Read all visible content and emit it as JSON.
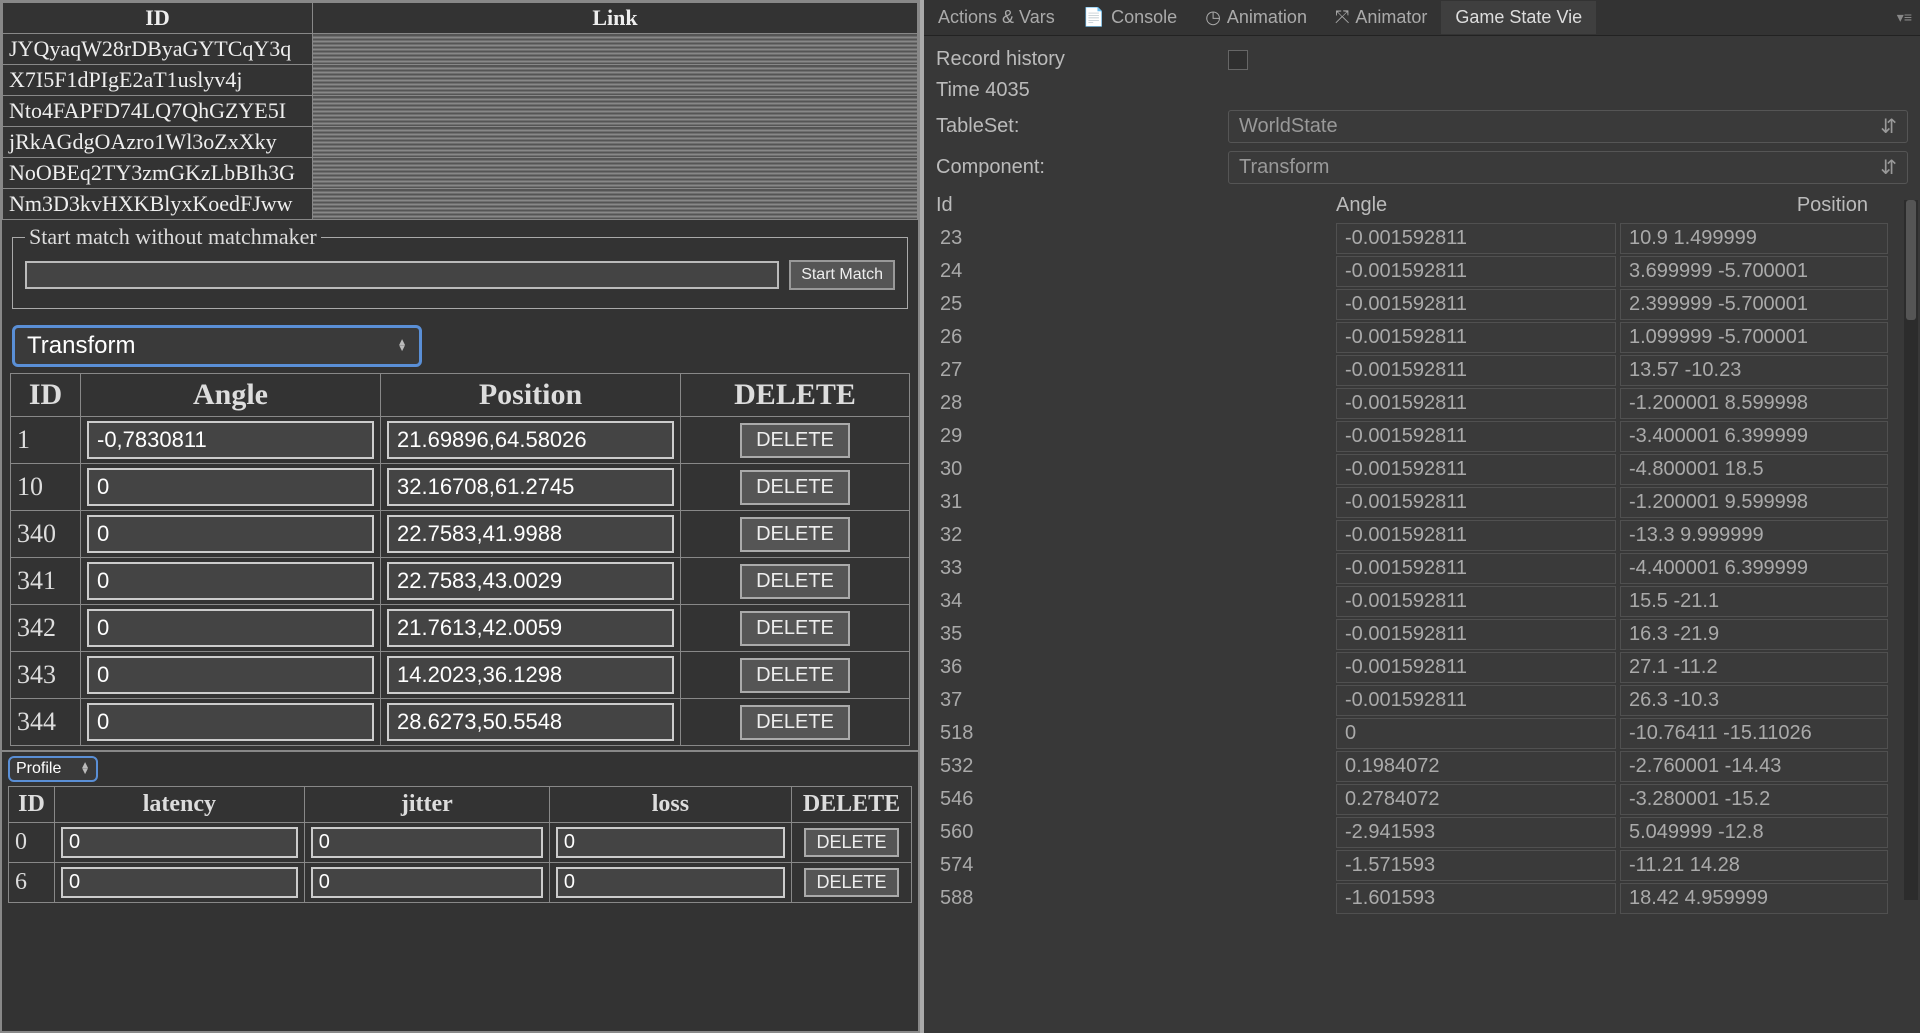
{
  "left": {
    "links_header": {
      "id": "ID",
      "link": "Link"
    },
    "links": [
      "JYQyaqW28rDByaGYTCqY3q",
      "X7I5F1dPIgE2aT1uslyv4j",
      "Nto4FAPFD74LQ7QhGZYE5I",
      "jRkAGdgOAzro1Wl3oZxXky",
      "NoOBEq2TY3zmGKzLbBIh3G",
      "Nm3D3kvHXKBlyxKoedFJww"
    ],
    "startmatch_legend": "Start match without matchmaker",
    "startmatch_input_value": "",
    "startmatch_button": "Start Match",
    "component_select": "Transform",
    "transform_header": {
      "id": "ID",
      "angle": "Angle",
      "position": "Position",
      "del": "DELETE"
    },
    "transform_rows": [
      {
        "id": "1",
        "angle": "-0,7830811",
        "position": "21.69896,64.58026"
      },
      {
        "id": "10",
        "angle": "0",
        "position": "32.16708,61.2745"
      },
      {
        "id": "340",
        "angle": "0",
        "position": "22.7583,41.9988"
      },
      {
        "id": "341",
        "angle": "0",
        "position": "22.7583,43.0029"
      },
      {
        "id": "342",
        "angle": "0",
        "position": "21.7613,42.0059"
      },
      {
        "id": "343",
        "angle": "0",
        "position": "14.2023,36.1298"
      },
      {
        "id": "344",
        "angle": "0",
        "position": "28.6273,50.5548"
      }
    ],
    "delete_label": "DELETE",
    "profile_select": "Profile",
    "profile_header": {
      "id": "ID",
      "latency": "latency",
      "jitter": "jitter",
      "loss": "loss",
      "del": "DELETE"
    },
    "profile_rows": [
      {
        "id": "0",
        "latency": "0",
        "jitter": "0",
        "loss": "0"
      },
      {
        "id": "6",
        "latency": "0",
        "jitter": "0",
        "loss": "0"
      }
    ]
  },
  "right": {
    "tabs": [
      {
        "label": "Actions & Vars",
        "icon": ""
      },
      {
        "label": "Console",
        "icon": "doc-icon"
      },
      {
        "label": "Animation",
        "icon": "clock-icon"
      },
      {
        "label": "Animator",
        "icon": "animator-icon"
      },
      {
        "label": "Game State Vie",
        "icon": ""
      }
    ],
    "active_tab": 4,
    "record_history_label": "Record history",
    "record_history_checked": false,
    "time_label": "Time 4035",
    "tableset_label": "TableSet:",
    "tableset_value": "WorldState",
    "component_label": "Component:",
    "component_value": "Transform",
    "gs_header": {
      "id": "Id",
      "angle": "Angle",
      "position": "Position"
    },
    "gs_rows": [
      {
        "id": "23",
        "angle": "-0.001592811",
        "position": "10.9 1.499999"
      },
      {
        "id": "24",
        "angle": "-0.001592811",
        "position": "3.699999 -5.700001"
      },
      {
        "id": "25",
        "angle": "-0.001592811",
        "position": "2.399999 -5.700001"
      },
      {
        "id": "26",
        "angle": "-0.001592811",
        "position": "1.099999 -5.700001"
      },
      {
        "id": "27",
        "angle": "-0.001592811",
        "position": "13.57 -10.23"
      },
      {
        "id": "28",
        "angle": "-0.001592811",
        "position": "-1.200001 8.599998"
      },
      {
        "id": "29",
        "angle": "-0.001592811",
        "position": "-3.400001 6.399999"
      },
      {
        "id": "30",
        "angle": "-0.001592811",
        "position": "-4.800001 18.5"
      },
      {
        "id": "31",
        "angle": "-0.001592811",
        "position": "-1.200001 9.599998"
      },
      {
        "id": "32",
        "angle": "-0.001592811",
        "position": "-13.3 9.999999"
      },
      {
        "id": "33",
        "angle": "-0.001592811",
        "position": "-4.400001 6.399999"
      },
      {
        "id": "34",
        "angle": "-0.001592811",
        "position": "15.5 -21.1"
      },
      {
        "id": "35",
        "angle": "-0.001592811",
        "position": "16.3 -21.9"
      },
      {
        "id": "36",
        "angle": "-0.001592811",
        "position": "27.1 -11.2"
      },
      {
        "id": "37",
        "angle": "-0.001592811",
        "position": "26.3 -10.3"
      },
      {
        "id": "518",
        "angle": "0",
        "position": "-10.76411 -15.11026"
      },
      {
        "id": "532",
        "angle": "0.1984072",
        "position": "-2.760001 -14.43"
      },
      {
        "id": "546",
        "angle": "0.2784072",
        "position": "-3.280001 -15.2"
      },
      {
        "id": "560",
        "angle": "-2.941593",
        "position": "5.049999 -12.8"
      },
      {
        "id": "574",
        "angle": "-1.571593",
        "position": "-11.21 14.28"
      },
      {
        "id": "588",
        "angle": "-1.601593",
        "position": "18.42 4.959999"
      }
    ]
  }
}
